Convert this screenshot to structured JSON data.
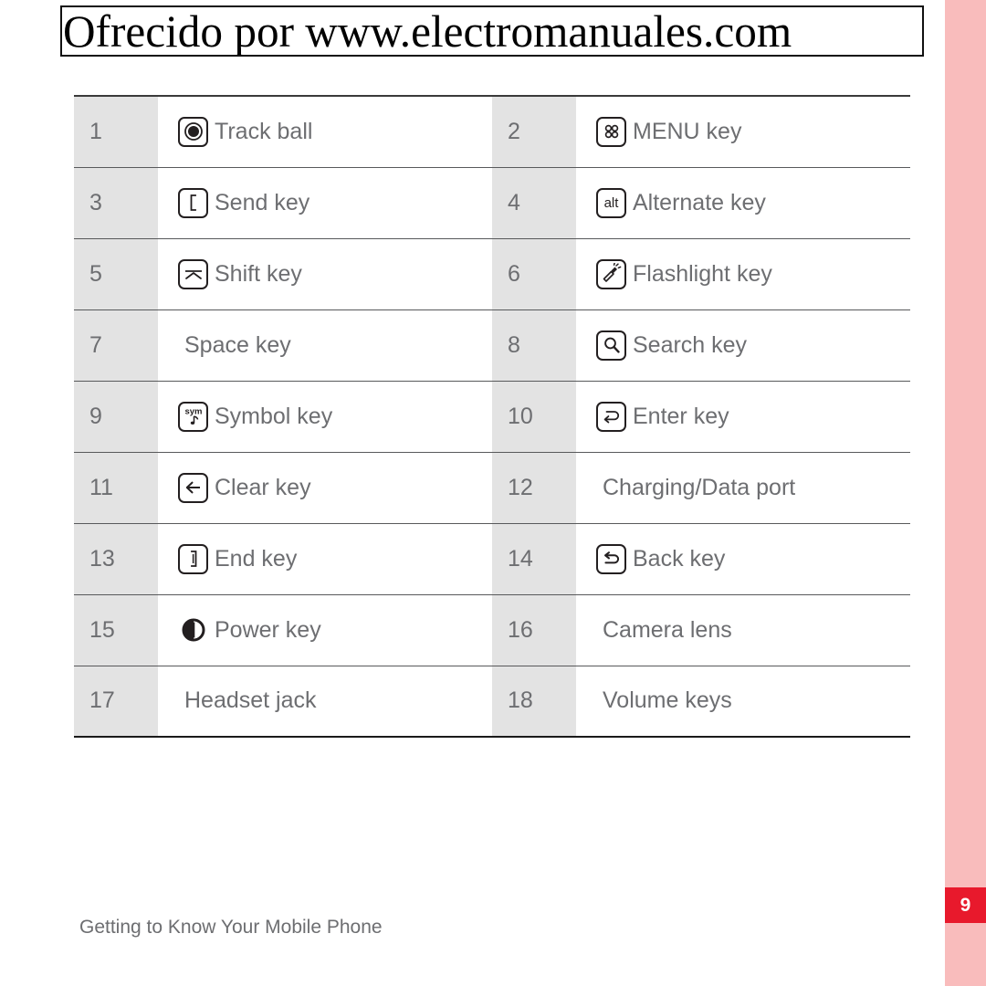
{
  "watermark": {
    "text": "Ofrecido por www.electromanuales.com"
  },
  "page_badge": {
    "number": "9",
    "background_color": "#e8192c",
    "text_color": "#ffffff"
  },
  "edge_stripe": {
    "color": "#f9bcbc"
  },
  "footer": {
    "text": "Getting to Know Your Mobile Phone"
  },
  "table": {
    "rows": [
      {
        "left": {
          "number": "1",
          "icon": "trackball-icon",
          "label": "Track ball"
        },
        "right": {
          "number": "2",
          "icon": "menu-grid-icon",
          "label": "MENU key"
        }
      },
      {
        "left": {
          "number": "3",
          "icon": "send-bracket-icon",
          "label": "Send key"
        },
        "right": {
          "number": "4",
          "icon": "alt-text-icon",
          "label": "Alternate key"
        }
      },
      {
        "left": {
          "number": "5",
          "icon": "shift-caret-icon",
          "label": "Shift key"
        },
        "right": {
          "number": "6",
          "icon": "flashlight-icon",
          "label": "Flashlight key"
        }
      },
      {
        "left": {
          "number": "7",
          "icon": "none",
          "label": "Space key"
        },
        "right": {
          "number": "8",
          "icon": "search-icon",
          "label": "Search key"
        }
      },
      {
        "left": {
          "number": "9",
          "icon": "symbol-sym-icon",
          "label": "Symbol key"
        },
        "right": {
          "number": "10",
          "icon": "enter-return-icon",
          "label": "Enter key"
        }
      },
      {
        "left": {
          "number": "11",
          "icon": "clear-arrow-left-icon",
          "label": "Clear key"
        },
        "right": {
          "number": "12",
          "icon": "none",
          "label": "Charging/Data port"
        }
      },
      {
        "left": {
          "number": "13",
          "icon": "end-bracket-icon",
          "label": "End key"
        },
        "right": {
          "number": "14",
          "icon": "back-arrow-icon",
          "label": "Back key"
        }
      },
      {
        "left": {
          "number": "15",
          "icon": "power-icon",
          "label": "Power key"
        },
        "right": {
          "number": "16",
          "icon": "none",
          "label": "Camera lens"
        }
      },
      {
        "left": {
          "number": "17",
          "icon": "none",
          "label": "Headset jack"
        },
        "right": {
          "number": "18",
          "icon": "none",
          "label": "Volume keys"
        }
      }
    ],
    "icon_labels": {
      "alt": "alt",
      "sym": "sym"
    }
  }
}
